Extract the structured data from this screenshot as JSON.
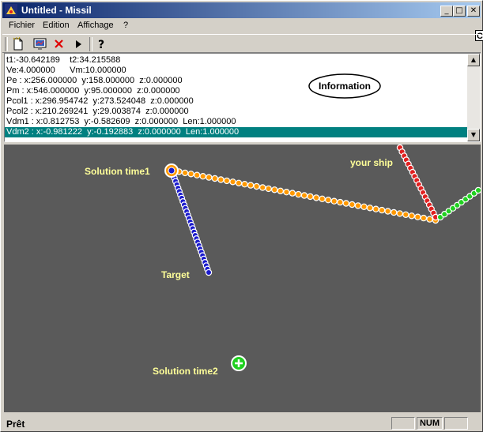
{
  "window": {
    "title": "Untitled - Missil",
    "minimize": "_",
    "maximize": "□",
    "close": "✕"
  },
  "menu": [
    "Fichier",
    "Edition",
    "Affichage",
    "?"
  ],
  "cut_label": "C",
  "info": {
    "lines": [
      "t1:-30.642189    t2:34.215588",
      "Ve:4.000000      Vm:10.000000",
      "Pe : x:256.000000  y:158.000000  z:0.000000",
      "Pm : x:546.000000  y:95.000000  z:0.000000",
      "Pcol1 : x:296.954742  y:273.524048  z:0.000000",
      "Pcol2 : x:210.269241  y:29.003874  z:0.000000",
      "Vdm1 : x:0.812753  y:-0.582609  z:0.000000  Len:1.000000",
      "Vdm2 : x:-0.981222  y:-0.192883  z:0.000000  Len:1.000000"
    ],
    "badge": "Information"
  },
  "canvas": {
    "labels": {
      "solution1": "Solution time1",
      "your_ship": "your ship",
      "target": "Target",
      "solution2": "Solution time2"
    },
    "colors": {
      "background": "#5a5a5a",
      "target_trail": "#1a1acc",
      "solution_trail": "#ff9900",
      "ship_trail": "#e02020",
      "ship_future": "#20d020",
      "label": "#ffff99"
    }
  },
  "status": {
    "text": "Prêt",
    "num": "NUM"
  }
}
